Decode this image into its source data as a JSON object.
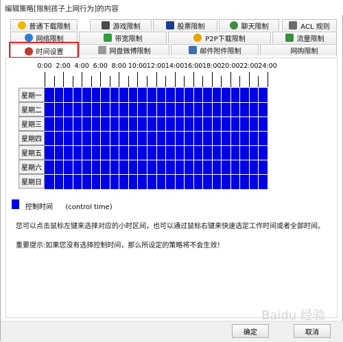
{
  "window": {
    "title": "编辑策略[限制孩子上网行为]的内容"
  },
  "tabs": {
    "row1": [
      {
        "label": "普通下载限制",
        "icon": "download-icon",
        "color": "#f2b705"
      },
      {
        "label": "游戏限制",
        "icon": "game-icon",
        "color": "#4a4a4a"
      },
      {
        "label": "股票限制",
        "icon": "stock-icon",
        "color": "#1f3a93"
      },
      {
        "label": "聊天限制",
        "icon": "chat-icon",
        "color": "#3d8b3d"
      },
      {
        "label": "ACL 规则",
        "icon": "acl-icon",
        "color": "#6b6b6b"
      }
    ],
    "row2": [
      {
        "label": "网络限制",
        "icon": "network-icon",
        "color": "#2f7fd1"
      },
      {
        "label": "带宽限制",
        "icon": "bandwidth-icon",
        "color": "#2f9e44"
      },
      {
        "label": "P2P下载限制",
        "icon": "p2p-icon",
        "color": "#e9a400"
      },
      {
        "label": "流量限制",
        "icon": "traffic-icon",
        "color": "#3b8e3b"
      }
    ],
    "row3": [
      {
        "label": "时间设置",
        "icon": "clock-icon",
        "color": "#c0392b"
      },
      {
        "label": "网盘微博限制",
        "icon": "cloud-icon",
        "color": "#9a9a9a"
      },
      {
        "label": "邮件附件限制",
        "icon": "mail-icon",
        "color": "#3a6fb0"
      },
      {
        "label": "网购限制",
        "icon": "shopping-icon",
        "color": "#888888"
      }
    ]
  },
  "schedule": {
    "hour_labels": [
      "0:00",
      "2:00",
      "4:00",
      "6:00",
      "8:00",
      "10:00",
      "12:00",
      "14:00",
      "16:00",
      "18:00",
      "20:00",
      "22:00",
      "24:00"
    ],
    "days": [
      "星期一",
      "星期二",
      "星期三",
      "星期四",
      "星期五",
      "星期六",
      "星期日"
    ],
    "hours_per_day": 24,
    "selected_color": "#0000e6",
    "all_selected": true
  },
  "legend": {
    "label": "控制时间",
    "english": "(control time)",
    "color": "#0000e6"
  },
  "info_text": "您可以点击鼠标左键来选择对应的小时区间，也可以通过鼠标右键来快速选定工作时间或者全部时间。",
  "warning_text": "重要提示:如果您没有选择控制时间，那么所设定的策略将不会生效！",
  "buttons": {
    "ok": "确定",
    "cancel": "取消"
  },
  "watermark": "Baidu 经验"
}
